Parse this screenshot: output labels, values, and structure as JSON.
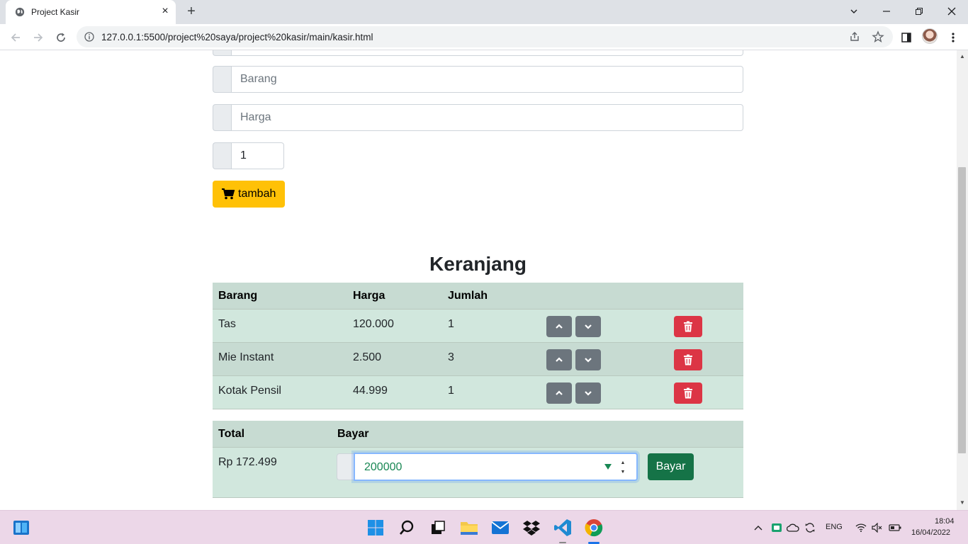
{
  "browser": {
    "tab_title": "Project Kasir",
    "tab_close": "×",
    "new_tab": "+",
    "url": "127.0.0.1:5500/project%20saya/project%20kasir/main/kasir.html"
  },
  "form": {
    "barang_placeholder": "Barang",
    "harga_placeholder": "Harga",
    "jumlah_value": "1",
    "tambah_label": "tambah"
  },
  "cart": {
    "heading": "Keranjang",
    "columns": [
      "Barang",
      "Harga",
      "Jumlah"
    ],
    "rows": [
      {
        "barang": "Tas",
        "harga": "120.000",
        "jumlah": "1"
      },
      {
        "barang": "Mie Instant",
        "harga": "2.500",
        "jumlah": "3"
      },
      {
        "barang": "Kotak Pensil",
        "harga": "44.999",
        "jumlah": "1"
      }
    ]
  },
  "payment": {
    "total_label": "Total",
    "bayar_label": "Bayar",
    "total_value": "Rp 172.499",
    "bayar_input_value": "200000",
    "bayar_button": "Bayar"
  },
  "taskbar": {
    "language": "ENG",
    "time": "18:04",
    "date": "16/04/2022"
  },
  "colors": {
    "warning": "#ffc107",
    "danger": "#dc3545",
    "secondary": "#6c757d",
    "success": "#157347",
    "table_row": "#d1e7dd",
    "table_row_alt": "#c7dbd2"
  }
}
